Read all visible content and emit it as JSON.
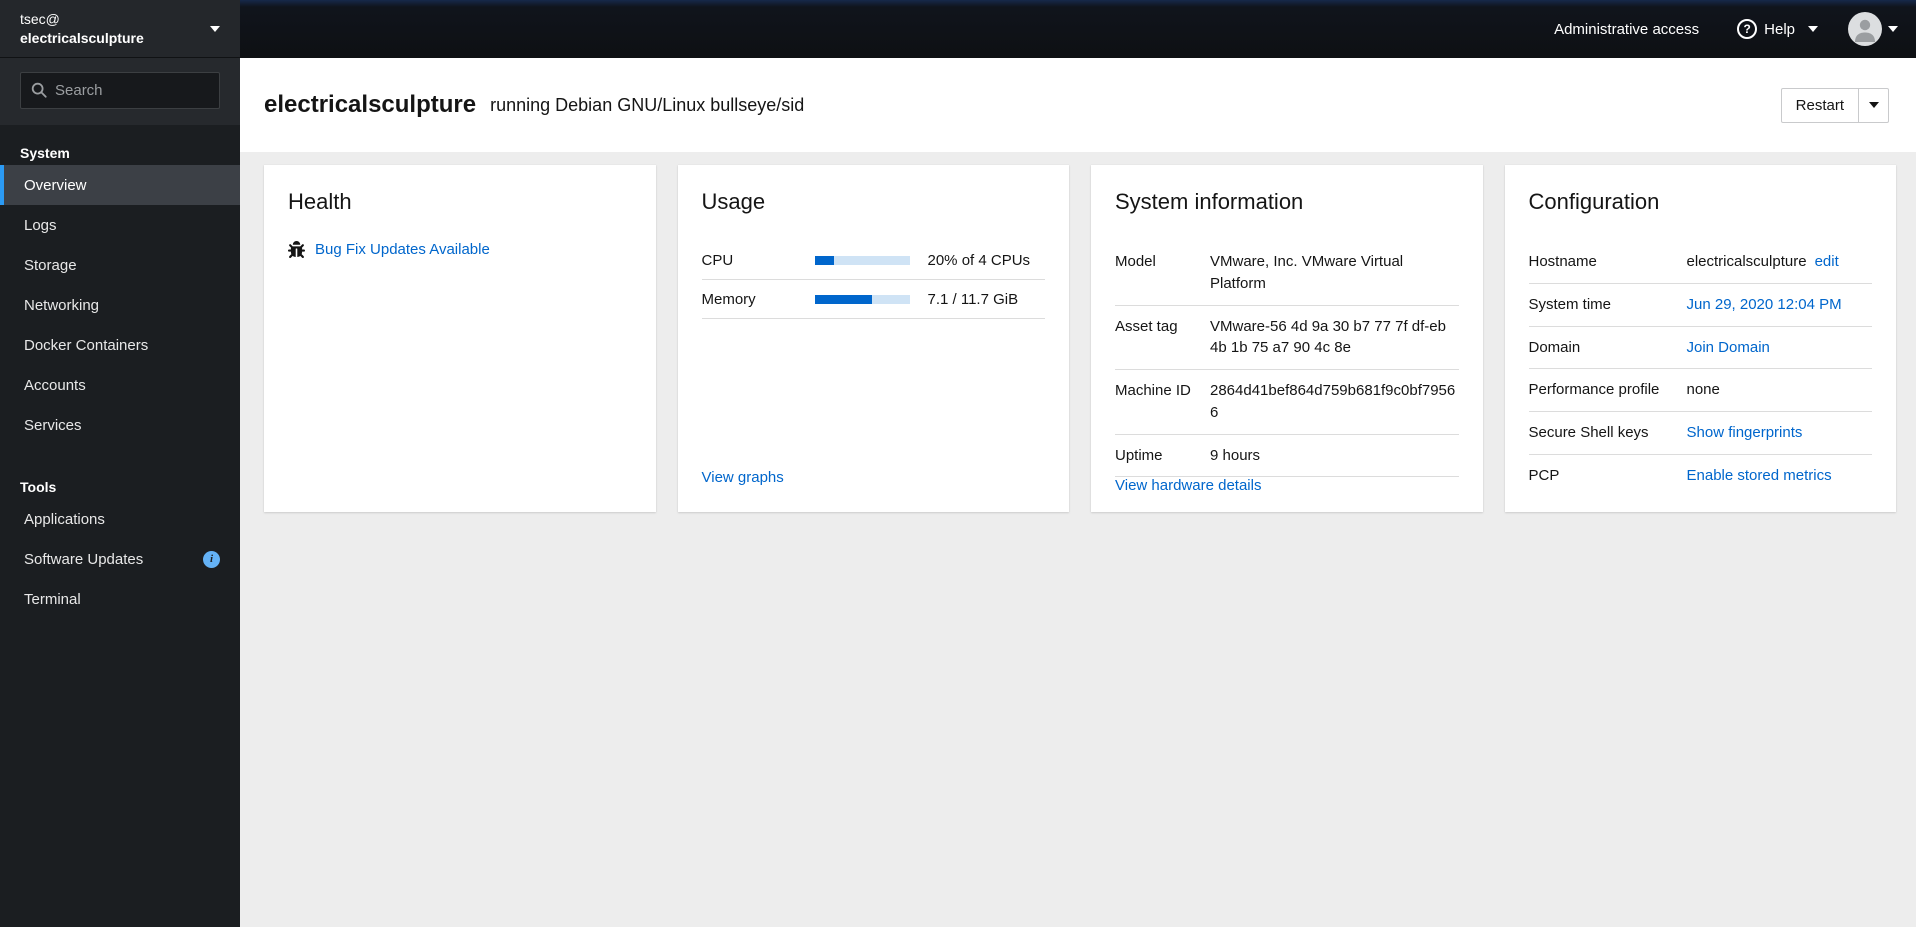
{
  "colors": {
    "accent_blue": "#0066cc",
    "nav_selected_border": "#2b9af3",
    "progress_track": "#cfe3f5",
    "sidebar_bg": "#1b1e21",
    "masthead_bg": "#0e1013",
    "content_bg": "#ededed",
    "info_badge_bg": "#64b2f6"
  },
  "icons": {
    "help_qmark": "?",
    "info_badge": "i"
  },
  "sidebar": {
    "user": "tsec@",
    "host": "electricalsculpture",
    "search_placeholder": "Search",
    "sections": [
      {
        "heading": "System",
        "items": [
          {
            "label": "Overview"
          },
          {
            "label": "Logs"
          },
          {
            "label": "Storage"
          },
          {
            "label": "Networking"
          },
          {
            "label": "Docker Containers"
          },
          {
            "label": "Accounts"
          },
          {
            "label": "Services"
          }
        ]
      },
      {
        "heading": "Tools",
        "items": [
          {
            "label": "Applications"
          },
          {
            "label": "Software Updates"
          },
          {
            "label": "Terminal"
          }
        ]
      }
    ]
  },
  "masthead": {
    "admin_access_label": "Administrative access",
    "help_label": "Help"
  },
  "header": {
    "hostname": "electricalsculpture",
    "subtitle": "running Debian GNU/Linux bullseye/sid",
    "restart_label": "Restart"
  },
  "cards": {
    "health": {
      "title": "Health",
      "update_link": "Bug Fix Updates Available"
    },
    "usage": {
      "title": "Usage",
      "rows": [
        {
          "label": "CPU",
          "percent": 20,
          "value": "20% of 4 CPUs"
        },
        {
          "label": "Memory",
          "percent": 61,
          "value": "7.1 / 11.7 GiB"
        }
      ],
      "footer_link": "View graphs"
    },
    "system_info": {
      "title": "System information",
      "rows": [
        {
          "label": "Model",
          "value": "VMware, Inc. VMware Virtual Platform"
        },
        {
          "label": "Asset tag",
          "value": "VMware-56 4d 9a 30 b7 77 7f df-eb 4b 1b 75 a7 90 4c 8e"
        },
        {
          "label": "Machine ID",
          "value": "2864d41bef864d759b681f9c0bf79566"
        },
        {
          "label": "Uptime",
          "value": "9 hours"
        }
      ],
      "footer_link": "View hardware details"
    },
    "configuration": {
      "title": "Configuration",
      "rows": [
        {
          "label": "Hostname",
          "text": "electricalsculpture",
          "link": "edit"
        },
        {
          "label": "System time",
          "link": "Jun 29, 2020 12:04 PM"
        },
        {
          "label": "Domain",
          "link": "Join Domain"
        },
        {
          "label": "Performance profile",
          "text": "none"
        },
        {
          "label": "Secure Shell keys",
          "link": "Show fingerprints"
        },
        {
          "label": "PCP",
          "link": "Enable stored metrics"
        }
      ]
    }
  }
}
